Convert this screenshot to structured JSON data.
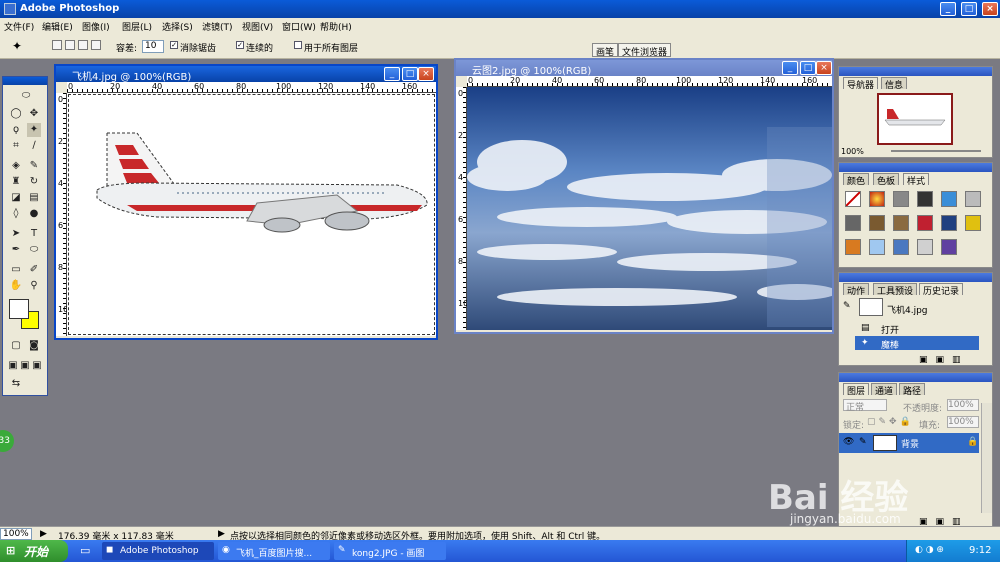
{
  "app": {
    "title": "Adobe Photoshop",
    "window_controls": [
      "_",
      "□",
      "×"
    ]
  },
  "menubar": [
    "文件(F)",
    "编辑(E)",
    "图像(I)",
    "图层(L)",
    "选择(S)",
    "滤镜(T)",
    "视图(V)",
    "窗口(W)",
    "帮助(H)"
  ],
  "options": {
    "tolerance_label": "容差:",
    "tolerance_value": "10",
    "antialias_label": "消除锯齿",
    "antialias_checked": true,
    "contiguous_label": "连续的",
    "contiguous_checked": true,
    "all_layers_label": "用于所有图层",
    "all_layers_checked": false,
    "palette_well_tabs": [
      "画笔",
      "文件浏览器"
    ]
  },
  "documents": [
    {
      "title": "飞机4.jpg @ 100%(RGB)",
      "ruler_ticks": [
        "0",
        "20",
        "40",
        "60",
        "80",
        "100",
        "120",
        "140",
        "160"
      ],
      "ruler_v_ticks": [
        "0",
        "2",
        "4",
        "6",
        "8",
        "10"
      ],
      "active": true
    },
    {
      "title": "云图2.jpg @ 100%(RGB)",
      "ruler_ticks": [
        "0",
        "20",
        "40",
        "60",
        "80",
        "100",
        "120",
        "140",
        "160"
      ],
      "ruler_v_ticks": [
        "0",
        "2",
        "4",
        "6",
        "8",
        "10"
      ],
      "active": false
    }
  ],
  "navigator": {
    "tabs": [
      "导航器",
      "信息"
    ],
    "zoom": "100%"
  },
  "color_palette": {
    "tabs": [
      "颜色",
      "色板",
      "样式"
    ]
  },
  "history": {
    "tabs": [
      "动作",
      "工具预设",
      "历史记录"
    ],
    "snapshot_name": "飞机4.jpg",
    "items": [
      "打开",
      "魔棒"
    ]
  },
  "layers": {
    "tabs": [
      "图层",
      "通道",
      "路径"
    ],
    "blend_mode": "正常",
    "opacity_label": "不透明度:",
    "opacity_value": "100%",
    "lock_label": "锁定:",
    "fill_label": "填充:",
    "fill_value": "100%",
    "layer_name": "背景"
  },
  "status": {
    "zoom": "100%",
    "doc_size": "176.39 毫米 x 117.83 毫米",
    "hint": "点按以选择相同颜色的邻近像素或移动选区外框。要用附加选项，使用 Shift、Alt 和 Ctrl 键。"
  },
  "taskbar": {
    "start_label": "开始",
    "items": [
      "Adobe Photoshop",
      "飞机_百度图片搜...",
      "kong2.JPG - 画图"
    ],
    "clock": "9:12"
  },
  "watermark": {
    "brand": "Bai 经验",
    "url": "jingyan.baidu.com"
  },
  "badge": "33",
  "colors": {
    "foreground": "#ffffff",
    "background": "#ffff00",
    "title_active": "#0842a8",
    "title_inactive": "#6a83c7"
  }
}
